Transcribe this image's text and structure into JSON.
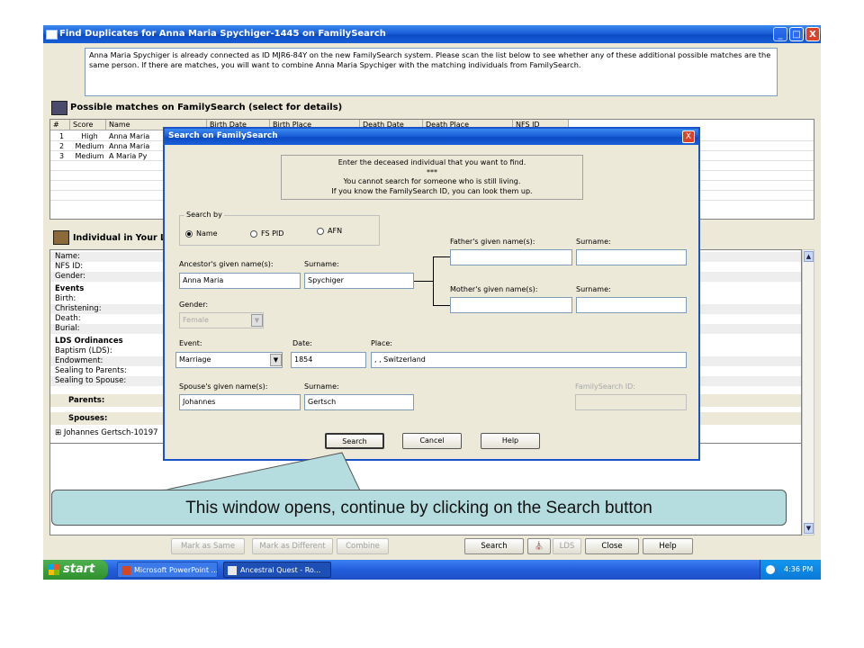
{
  "window": {
    "title": "Find Duplicates for Anna Maria Spychiger-1445 on FamilySearch",
    "controls": [
      "_",
      "□",
      "X"
    ]
  },
  "info_text": "Anna Maria Spychiger is already connected as ID MJR6-84Y on the new FamilySearch system. Please scan the list below to see whether any of these additional possible matches are the same person. If there are matches, you will want to combine Anna Maria Spychiger with the matching individuals from FamilySearch.",
  "matches": {
    "section_title": "Possible matches on FamilySearch (select for details)",
    "columns": [
      "#",
      "Score",
      "Name",
      "Birth Date",
      "Birth Place",
      "Death Date",
      "Death Place",
      "NFS ID"
    ],
    "rows": [
      {
        "num": "1",
        "score": "High",
        "name": "Anna Maria"
      },
      {
        "num": "2",
        "score": "Medium",
        "name": "Anna Maria"
      },
      {
        "num": "3",
        "score": "Medium",
        "name": "A Maria Py"
      }
    ]
  },
  "individual": {
    "section_title": "Individual in Your Lo",
    "rows": [
      {
        "label": "Name:",
        "style": "shade"
      },
      {
        "label": "NFS ID:",
        "style": ""
      },
      {
        "label": "Gender:",
        "style": "shade"
      },
      {
        "label": "Events",
        "style": "bold"
      },
      {
        "label": "Birth:",
        "style": ""
      },
      {
        "label": "Christening:",
        "style": "shade"
      },
      {
        "label": "Death:",
        "style": ""
      },
      {
        "label": "Burial:",
        "style": "shade"
      },
      {
        "label": "LDS Ordinances",
        "style": "bold"
      },
      {
        "label": "Baptism (LDS):",
        "style": ""
      },
      {
        "label": "Endowment:",
        "style": "shade"
      },
      {
        "label": "Sealing to Parents:",
        "style": ""
      },
      {
        "label": "Sealing to Spouse:",
        "style": "shade"
      }
    ],
    "parents_label": "Parents:",
    "spouses_label": "Spouses:",
    "spouse_entry": "Johannes Gertsch-10197",
    "expand_symbol": "⊞"
  },
  "bottom_buttons": [
    {
      "label": "Mark as Same",
      "disabled": true
    },
    {
      "label": "Mark as Different",
      "disabled": true
    },
    {
      "label": "Combine",
      "disabled": true
    },
    {
      "label": "Search",
      "disabled": false
    },
    {
      "label": "LDS",
      "disabled": true
    },
    {
      "label": "Close",
      "disabled": false
    },
    {
      "label": "Help",
      "disabled": false
    }
  ],
  "taskbar": {
    "start_label": "start",
    "items": [
      "Microsoft PowerPoint ...",
      "Ancestral Quest - Ro..."
    ],
    "clock": "4:36 PM"
  },
  "dialog": {
    "title": "Search on FamilySearch",
    "close_glyph": "X",
    "notice_lines": [
      "Enter the deceased individual that you want to find.",
      "***",
      "You cannot search for someone who is still living.",
      "If you know the FamilySearch ID, you can look them up."
    ],
    "search_by": {
      "label": "Search by",
      "options": [
        "Name",
        "FS PID",
        "AFN"
      ],
      "selected": "Name"
    },
    "ancestor_given_label": "Ancestor's given name(s):",
    "ancestor_given_value": "Anna Maria",
    "ancestor_surname_label": "Surname:",
    "ancestor_surname_value": "Spychiger",
    "gender_label": "Gender:",
    "gender_value": "Female",
    "father_given_label": "Father's given name(s):",
    "father_given_value": "",
    "father_surname_label": "Surname:",
    "father_surname_value": "",
    "mother_given_label": "Mother's given name(s):",
    "mother_given_value": "",
    "mother_surname_label": "Surname:",
    "mother_surname_value": "",
    "event_label": "Event:",
    "event_value": "Marriage",
    "date_label": "Date:",
    "date_value": "1854",
    "place_label": "Place:",
    "place_value": ", , Switzerland",
    "spouse_given_label": "Spouse's given name(s):",
    "spouse_given_value": "Johannes",
    "spouse_surname_label": "Surname:",
    "spouse_surname_value": "Gertsch",
    "fsid_label": "FamilySearch ID:",
    "fsid_value": "",
    "dropdown_arrow": "▼",
    "buttons": {
      "search": "Search",
      "cancel": "Cancel",
      "help": "Help"
    }
  },
  "callout": {
    "text": "This window opens, continue by clicking on the Search button"
  }
}
